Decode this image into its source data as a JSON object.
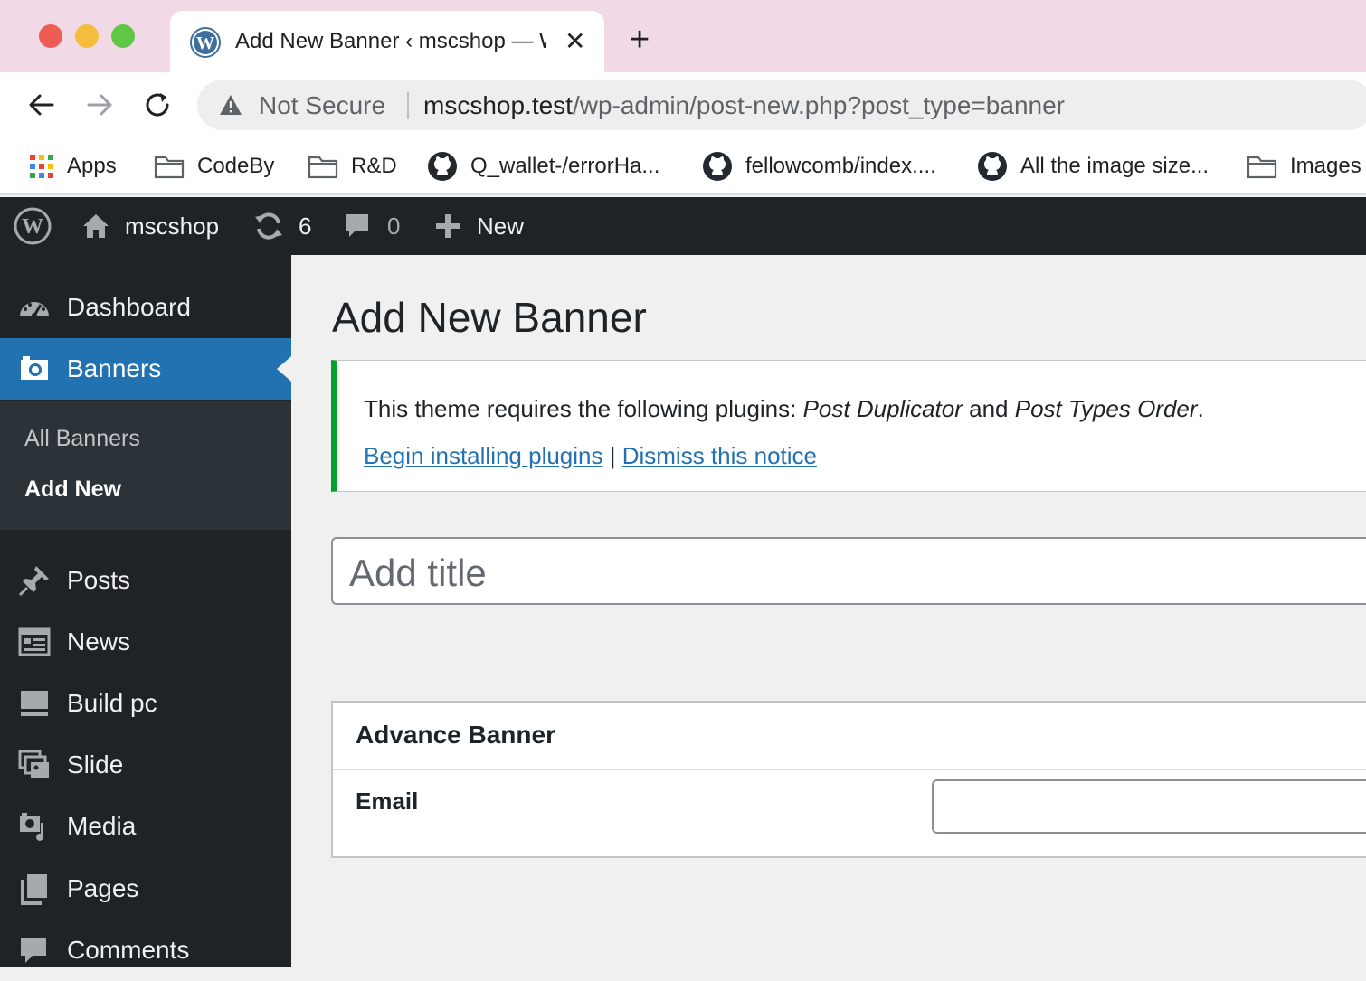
{
  "browser": {
    "tab_title": "Add New Banner ‹ mscshop — WordPress",
    "address_warning": "Not Secure",
    "url_host": "mscshop.test",
    "url_path": "/wp-admin/post-new.php?post_type=banner",
    "bookmarks": [
      {
        "label": "Apps",
        "icon": "apps-grid-icon"
      },
      {
        "label": "CodeBy",
        "icon": "folder-icon"
      },
      {
        "label": "R&D",
        "icon": "folder-icon"
      },
      {
        "label": "Q_wallet-/errorHa...",
        "icon": "github-icon"
      },
      {
        "label": "fellowcomb/index....",
        "icon": "github-icon"
      },
      {
        "label": "All the image size...",
        "icon": "github-icon"
      },
      {
        "label": "Images",
        "icon": "folder-icon"
      }
    ]
  },
  "adminbar": {
    "site_name": "mscshop",
    "updates_count": "6",
    "comments_count": "0",
    "new_label": "New"
  },
  "sidebar": {
    "items": [
      {
        "label": "Dashboard",
        "icon": "dashboard-icon"
      },
      {
        "label": "Banners",
        "icon": "camera-icon",
        "active": true
      },
      {
        "label": "Posts",
        "icon": "pin-icon"
      },
      {
        "label": "News",
        "icon": "news-icon"
      },
      {
        "label": "Build pc",
        "icon": "monitor-icon"
      },
      {
        "label": "Slide",
        "icon": "slides-icon"
      },
      {
        "label": "Media",
        "icon": "media-icon"
      },
      {
        "label": "Pages",
        "icon": "pages-icon"
      },
      {
        "label": "Comments",
        "icon": "comment-icon"
      }
    ],
    "submenu": {
      "all": "All Banners",
      "add": "Add New"
    }
  },
  "main": {
    "page_title": "Add New Banner",
    "notice": {
      "text_prefix": "This theme requires the following plugins: ",
      "plugin1": "Post Duplicator",
      "text_and": " and ",
      "plugin2": "Post Types Order",
      "text_suffix": ".",
      "link_install": "Begin installing plugins",
      "separator": " | ",
      "link_dismiss": "Dismiss this notice"
    },
    "title_placeholder": "Add title",
    "metabox": {
      "title": "Advance Banner",
      "email_label": "Email",
      "email_value": ""
    }
  },
  "colors": {
    "accent": "#2271b1",
    "adminbar_bg": "#1d2327",
    "notice_success": "#00a32a"
  }
}
